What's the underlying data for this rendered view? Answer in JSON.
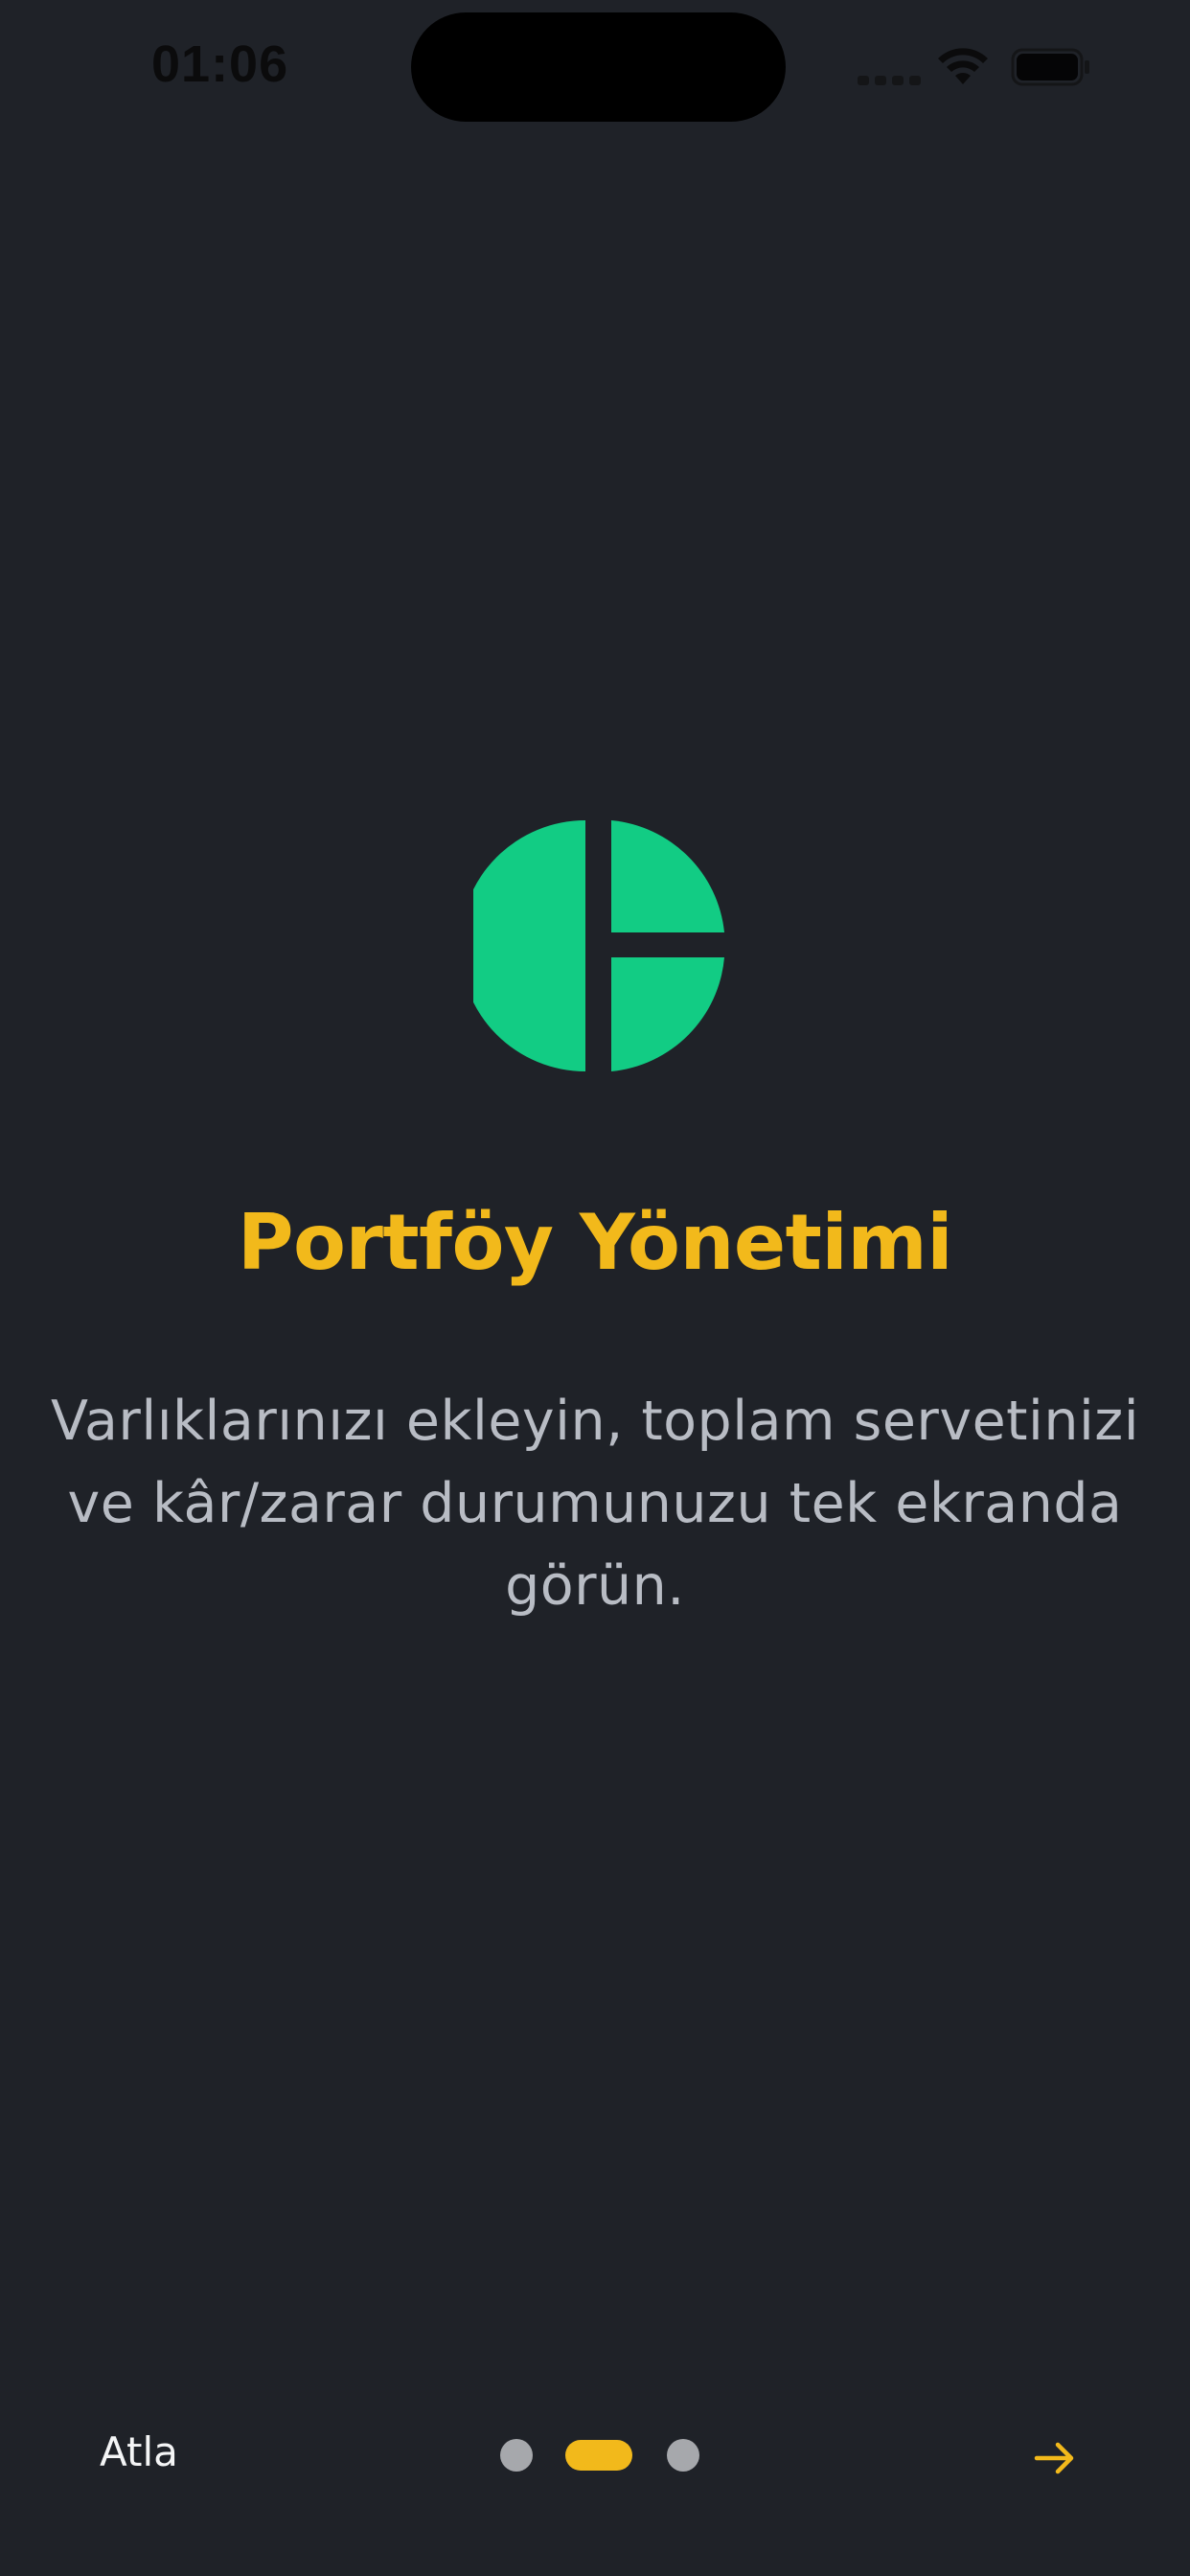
{
  "status_bar": {
    "time": "01:06"
  },
  "onboarding": {
    "logo_icon": "portfolio-pie-icon",
    "title": "Portföy Yönetimi",
    "description": "Varlıklarınızı ekleyin, toplam servetinizi ve kâr/zarar durumunuzu tek ekranda görün."
  },
  "navigation": {
    "skip_label": "Atla",
    "next_icon": "arrow-right-icon",
    "pages_total": 3,
    "current_page": 2
  },
  "colors": {
    "background": "#1f2228",
    "accent": "#f2b91b",
    "logo": "#12cc84",
    "description_text": "#b8bcc4",
    "dot_inactive": "#a6a8ac"
  }
}
